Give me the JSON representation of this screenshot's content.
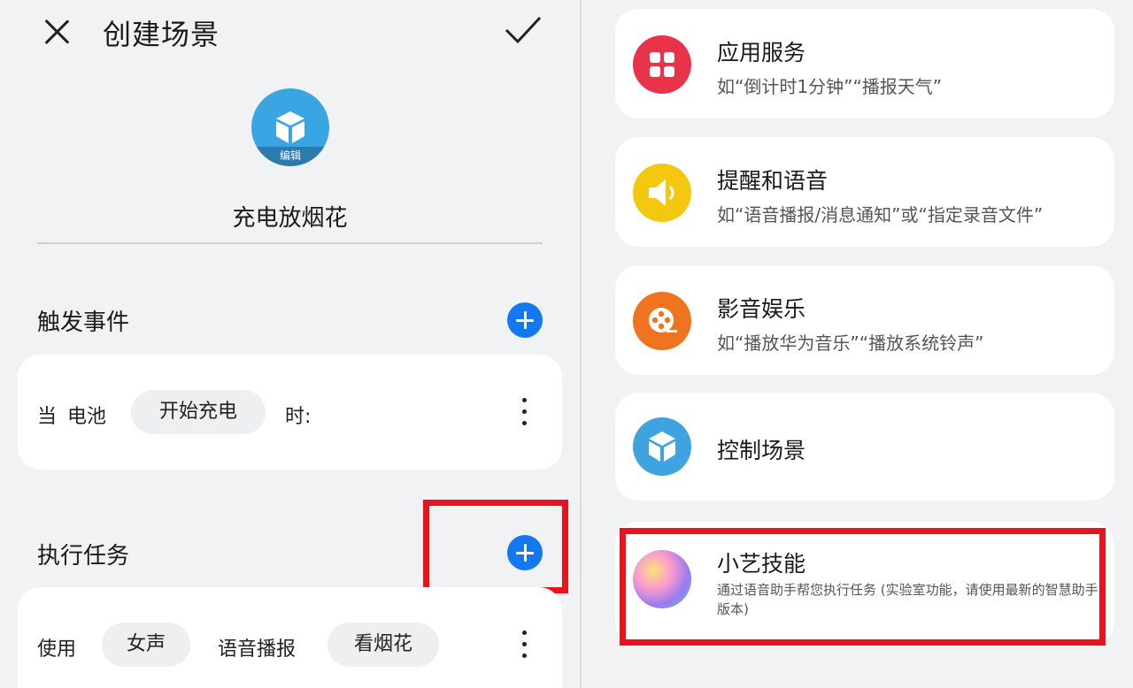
{
  "header": {
    "title": "创建场景"
  },
  "scene": {
    "edit_label": "编辑",
    "name": "充电放烟花"
  },
  "trigger_section": {
    "title": "触发事件",
    "row": {
      "prefix": "当",
      "device": "电池",
      "chip": "开始充电",
      "suffix": "时:"
    }
  },
  "task_section": {
    "title": "执行任务",
    "row": {
      "prefix": "使用",
      "chip_voice": "女声",
      "action": "语音播报",
      "chip_content": "看烟花"
    }
  },
  "options": [
    {
      "title": "应用服务",
      "desc": "如“倒计时1分钟”“播报天气”",
      "icon": "apps-grid-icon",
      "color": "#e8334a"
    },
    {
      "title": "提醒和语音",
      "desc": "如“语音播报/消息通知”或“指定录音文件”",
      "icon": "speaker-icon",
      "color": "#f3c80f"
    },
    {
      "title": "影音娱乐",
      "desc": "如“播放华为音乐”“播放系统铃声”",
      "icon": "film-reel-icon",
      "color": "#f07320"
    },
    {
      "title": "控制场景",
      "desc": "",
      "icon": "scene-cube-icon",
      "color": "#3ea3de"
    },
    {
      "title": "小艺技能",
      "desc": "通过语音助手帮您执行任务 (实验室功能，请使用最新的智慧助手版本)",
      "icon": "xiaoyi-orb-icon",
      "color": "#c77ad8"
    }
  ],
  "colors": {
    "accent_blue": "#1478f0",
    "highlight_red": "#e8141b",
    "background": "#f1f2f4"
  }
}
